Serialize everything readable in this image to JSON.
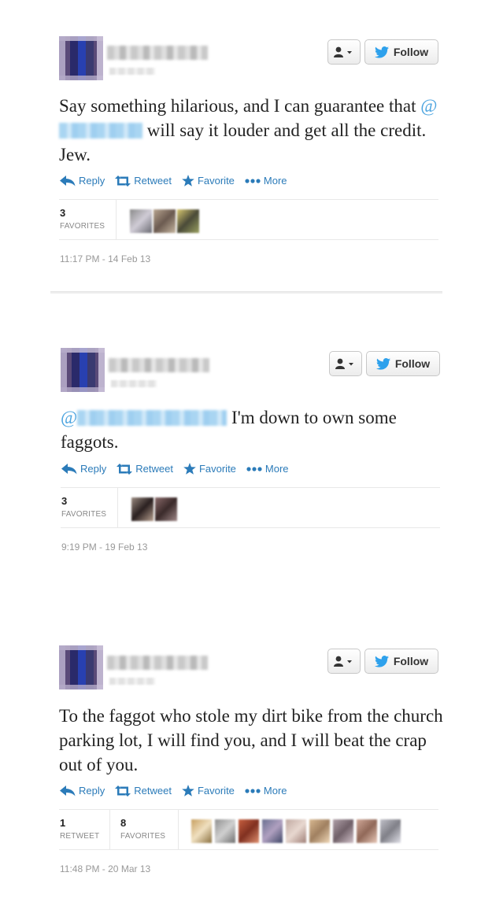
{
  "follow_label": "Follow",
  "colors": {
    "link": "#2b7bb9",
    "mention": "#4aa3df",
    "twitter_blue": "#2ea1ec"
  },
  "actions": {
    "reply": "Reply",
    "retweet": "Retweet",
    "favorite": "Favorite",
    "more": "More"
  },
  "tweets": [
    {
      "text_before": "Say something hilarious, and I can guarantee that ",
      "mention_prefix": "@",
      "text_after": " will say it louder and get all the credit. Jew.",
      "favorites_count": "3",
      "favorites_label": "FAVORITES",
      "timestamp": "11:17 PM - 14 Feb 13"
    },
    {
      "text_before": "",
      "mention_prefix": "@",
      "text_after": " I'm down to own some faggots.",
      "favorites_count": "3",
      "favorites_label": "FAVORITES",
      "timestamp": "9:19 PM - 19 Feb 13"
    },
    {
      "text": "To the faggot who stole my dirt bike from the church parking lot, I will find you, and I will beat the crap out of you.",
      "retweets_count": "1",
      "retweets_label": "RETWEET",
      "favorites_count": "8",
      "favorites_label": "FAVORITES",
      "timestamp": "11:48 PM - 20 Mar 13"
    }
  ]
}
